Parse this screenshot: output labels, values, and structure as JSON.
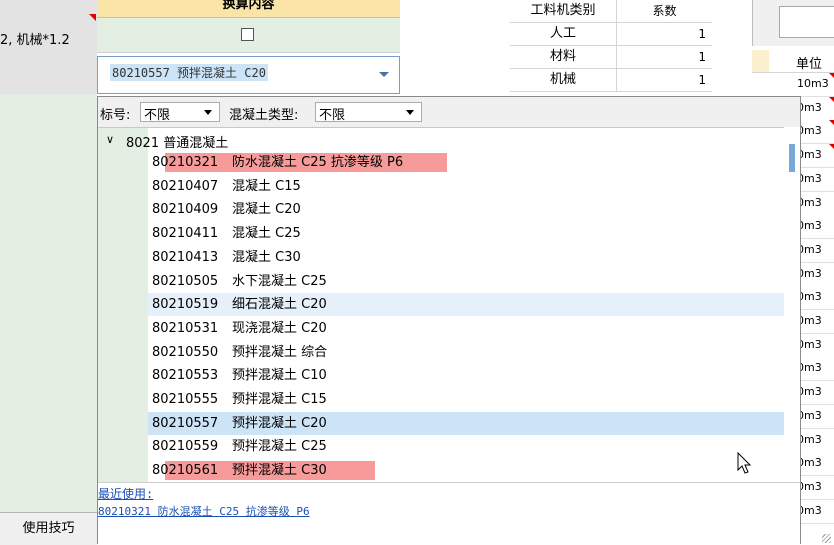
{
  "left": {
    "top_text": "2, 机械*1.2",
    "tips_button": "使用技巧"
  },
  "header": {
    "title": "换算内容"
  },
  "combo": {
    "value": "80210557  预拌混凝土 C20"
  },
  "right_table": {
    "headers": [
      "工料机类别",
      "系数"
    ],
    "rows": [
      {
        "category": "人工",
        "coef": "1"
      },
      {
        "category": "材料",
        "coef": "1"
      },
      {
        "category": "机械",
        "coef": "1"
      }
    ]
  },
  "far_right": {
    "unit_header": "单位",
    "units": [
      "10m3",
      "0m3",
      "0m3",
      "0m3",
      "0m3",
      "0m3",
      "0m3",
      "0m3",
      "0m3",
      "0m3",
      "0m3",
      "0m3",
      "0m3",
      "0m3",
      "0m3",
      "0m3",
      "0m3",
      "0m3",
      "0m3"
    ]
  },
  "popup": {
    "filter": {
      "grade_label": "标号:",
      "grade_value": "不限",
      "type_label": "混凝土类型:",
      "type_value": "不限"
    },
    "group": {
      "expander": "∨",
      "label": "8021 普通混凝土"
    },
    "items": [
      {
        "code": "80210321",
        "name": "防水混凝土 C25 抗渗等级 P6",
        "style": "red"
      },
      {
        "code": "80210407",
        "name": "混凝土 C15",
        "style": "normal"
      },
      {
        "code": "80210409",
        "name": "混凝土 C20",
        "style": "normal"
      },
      {
        "code": "80210411",
        "name": "混凝土 C25",
        "style": "normal"
      },
      {
        "code": "80210413",
        "name": "混凝土 C30",
        "style": "normal"
      },
      {
        "code": "80210505",
        "name": "水下混凝土 C25",
        "style": "normal"
      },
      {
        "code": "80210519",
        "name": "细石混凝土 C20",
        "style": "alt"
      },
      {
        "code": "80210531",
        "name": "现浇混凝土 C20",
        "style": "normal"
      },
      {
        "code": "80210550",
        "name": "预拌混凝土 综合",
        "style": "normal"
      },
      {
        "code": "80210553",
        "name": "预拌混凝土 C10",
        "style": "normal"
      },
      {
        "code": "80210555",
        "name": "预拌混凝土 C15",
        "style": "normal"
      },
      {
        "code": "80210557",
        "name": "预拌混凝土 C20",
        "style": "sel"
      },
      {
        "code": "80210559",
        "name": "预拌混凝土 C25",
        "style": "normal"
      },
      {
        "code": "80210561",
        "name": "预拌混凝土 C30",
        "style": "red"
      }
    ],
    "recent_label": "最近使用:",
    "recent_item": "80210321  防水混凝土 C25 抗渗等级 P6"
  }
}
